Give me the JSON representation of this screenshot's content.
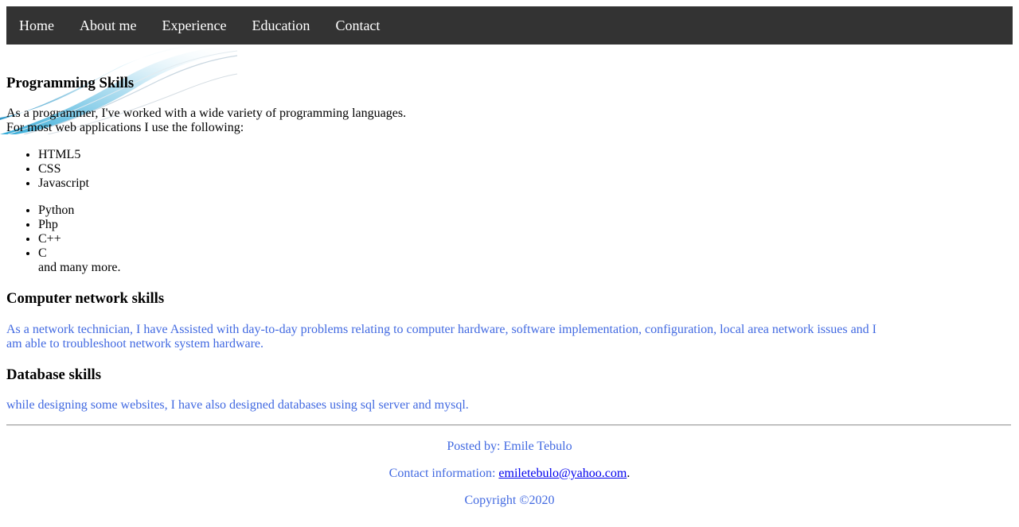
{
  "nav": {
    "items": [
      {
        "label": "Home"
      },
      {
        "label": "About me"
      },
      {
        "label": "Experience"
      },
      {
        "label": "Education"
      },
      {
        "label": "Contact"
      }
    ]
  },
  "programming": {
    "title": "Programming Skills",
    "intro_line1": "As a programmer, I've worked with a wide variety of programming languages.",
    "intro_line2": "For most web applications I use the following:",
    "list1": [
      "HTML5",
      "CSS",
      "Javascript"
    ],
    "list2": [
      "Python",
      "Php",
      "C++",
      "C"
    ],
    "more": "and many more."
  },
  "network": {
    "title": "Computer network skills",
    "text": "As a network technician, I have Assisted with day-to-day problems relating to computer hardware, software implementation, configuration, local area network issues and I am able to troubleshoot network system hardware."
  },
  "database": {
    "title": "Database skills",
    "text": "while designing some websites, I have also designed databases using sql server and mysql."
  },
  "footer": {
    "posted_by": "Posted by: Emile Tebulo",
    "contact_prefix": "Contact information: ",
    "email": "emiletebulo@yahoo.com",
    "contact_suffix": ".",
    "copyright": "Copyright ©2020"
  },
  "colors": {
    "nav_background": "#333333",
    "accent_text": "#4169e1"
  }
}
